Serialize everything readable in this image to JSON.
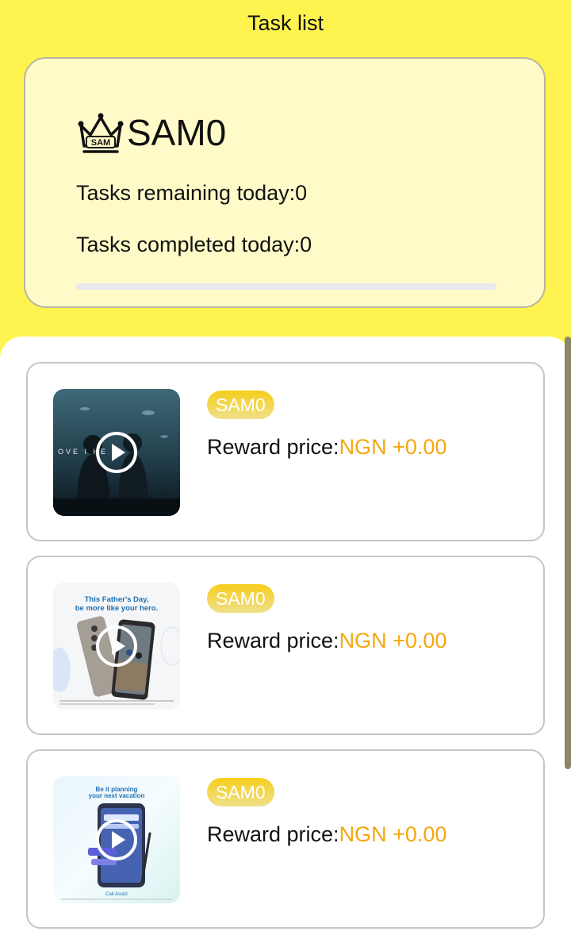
{
  "header": {
    "title": "Task list"
  },
  "summary": {
    "level_name": "SAM0",
    "crown_badge_text": "SAM",
    "tasks_remaining": "Tasks remaining today:0",
    "tasks_completed": "Tasks completed today:0",
    "progress_fraction": 0
  },
  "tasks": [
    {
      "tag": "SAM0",
      "reward_label": "Reward price:",
      "reward_value": "NGN +0.00",
      "thumbnail": {
        "icon": "play-icon",
        "overlay_text": "OVE I    HE AI"
      }
    },
    {
      "tag": "SAM0",
      "reward_label": "Reward price:",
      "reward_value": "NGN +0.00",
      "thumbnail": {
        "icon": "play-icon",
        "headline_1": "This Father's Day,",
        "headline_2": "be more like your hero."
      }
    },
    {
      "tag": "SAM0",
      "reward_label": "Reward price:",
      "reward_value": "NGN +0.00",
      "thumbnail": {
        "icon": "play-icon",
        "headline_1": "Be it planning",
        "headline_2": "your next vacation",
        "footer": "Call Assist"
      }
    }
  ],
  "colors": {
    "background": "#fff44f",
    "card": "#fffbc9",
    "accent": "#f5a70f",
    "tag": "#f6ce1c"
  }
}
